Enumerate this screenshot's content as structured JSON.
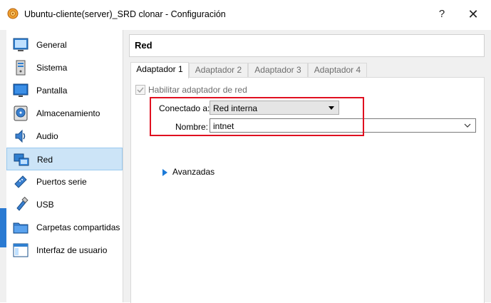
{
  "window": {
    "title": "Ubuntu-cliente(server)_SRD clonar - Configuración",
    "help_label": "?",
    "close_label": "✕"
  },
  "sidebar": {
    "items": [
      {
        "label": "General",
        "icon": "general-icon"
      },
      {
        "label": "Sistema",
        "icon": "system-icon"
      },
      {
        "label": "Pantalla",
        "icon": "display-icon"
      },
      {
        "label": "Almacenamiento",
        "icon": "storage-icon"
      },
      {
        "label": "Audio",
        "icon": "audio-icon"
      },
      {
        "label": "Red",
        "icon": "network-icon",
        "selected": true
      },
      {
        "label": "Puertos serie",
        "icon": "serial-ports-icon"
      },
      {
        "label": "USB",
        "icon": "usb-icon"
      },
      {
        "label": "Carpetas compartidas",
        "icon": "shared-folders-icon"
      },
      {
        "label": "Interfaz de usuario",
        "icon": "user-interface-icon"
      }
    ]
  },
  "main": {
    "section_title": "Red",
    "tabs": [
      {
        "label": "Adaptador 1",
        "active": true
      },
      {
        "label": "Adaptador 2"
      },
      {
        "label": "Adaptador 3"
      },
      {
        "label": "Adaptador 4"
      }
    ],
    "enable_adapter_label": "Habilitar adaptador de red",
    "attached_to_label": "Conectado a:",
    "attached_to_value": "Red interna",
    "name_label": "Nombre:",
    "name_value": "intnet",
    "advanced_label": "Avanzadas"
  },
  "colors": {
    "selection_bg": "#cce4f7",
    "highlight_border": "#e01020",
    "accent_blue": "#1c7ad8"
  }
}
